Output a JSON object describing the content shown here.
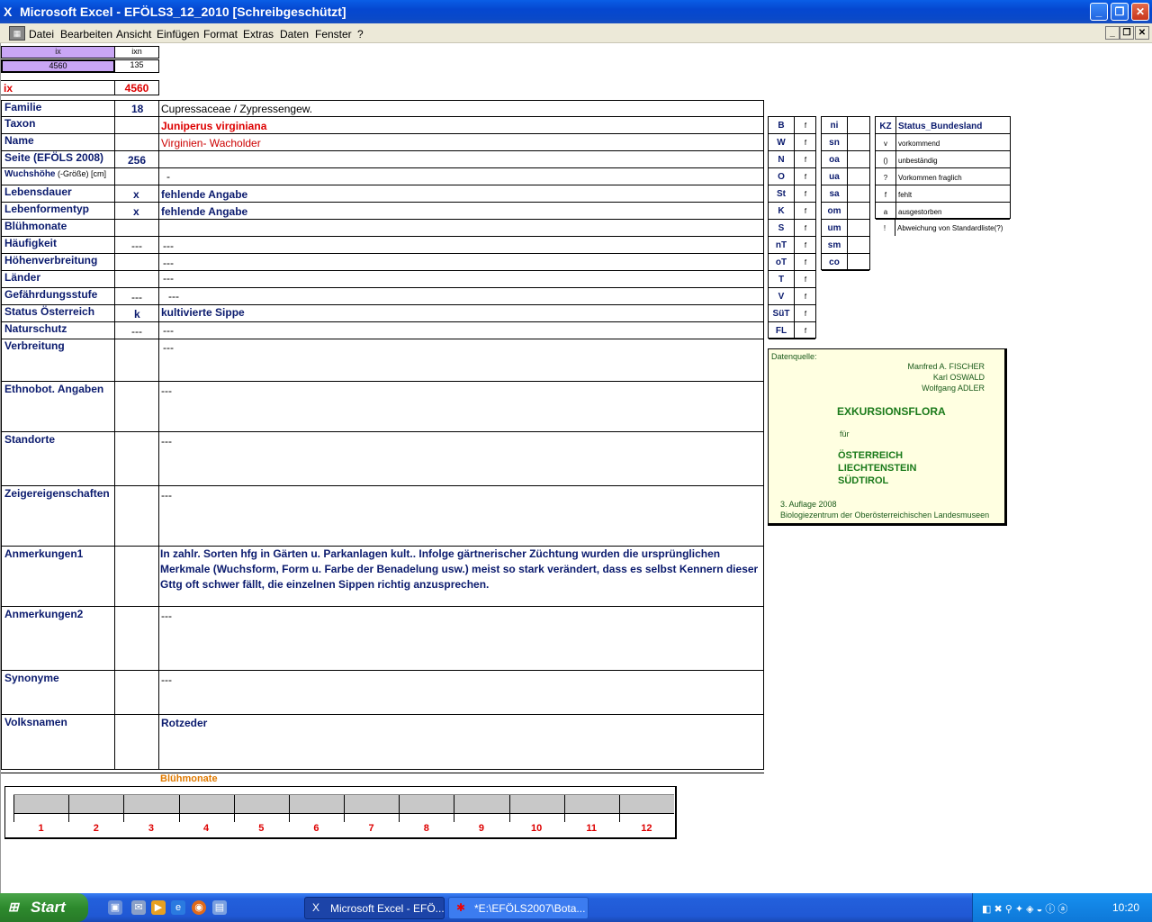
{
  "titlebar": {
    "title": "Microsoft Excel - EFÖLS3_12_2010  [Schreibgeschützt]"
  },
  "window_buttons": {
    "minimize": "_",
    "maximize": "❐",
    "close": "✕"
  },
  "menu": [
    "Datei",
    "Bearbeiten",
    "Ansicht",
    "Einfügen",
    "Format",
    "Extras",
    "Daten",
    "Fenster",
    "?"
  ],
  "top_index": {
    "h1": "ix",
    "h2": "ixn",
    "v1": "4560",
    "v2": "135",
    "ix_label": "ix",
    "ix_value": "4560"
  },
  "record": {
    "familie": {
      "label": "Familie",
      "code": "18",
      "value": "Cupressaceae  /  Zypressengew."
    },
    "taxon": {
      "label": "Taxon",
      "value": "Juniperus virginiana"
    },
    "name": {
      "label": "Name",
      "value": "Virginien- Wacholder"
    },
    "seite": {
      "label": "Seite (EFÖLS 2008)",
      "code": "256"
    },
    "wuchshoehe": {
      "label": "Wuchshöhe",
      "label_small": " (-Größe) [cm]",
      "value": "-"
    },
    "lebensdauer": {
      "label": "Lebensdauer",
      "code": "x",
      "value": "fehlende Angabe"
    },
    "lebensformentyp": {
      "label": "Lebenformentyp",
      "code": "x",
      "value": "fehlende Angabe"
    },
    "bluehmonate": {
      "label": "Blühmonate"
    },
    "haeufigkeit": {
      "label": "Häufigkeit",
      "code": "---",
      "value": "---"
    },
    "hoehenverbreitung": {
      "label": "Höhenverbreitung",
      "value": "---"
    },
    "laender": {
      "label": "Länder",
      "value": "---"
    },
    "gefaehrdung": {
      "label": "Gefährdungsstufe",
      "code": "---",
      "value": "---"
    },
    "status": {
      "label": "Status Österreich",
      "code": "k",
      "value": "kultivierte Sippe"
    },
    "naturschutz": {
      "label": "Naturschutz",
      "code": "---",
      "value": "---"
    },
    "verbreitung": {
      "label": "Verbreitung",
      "value": "---"
    },
    "ethnobot": {
      "label": "Ethnobot. Angaben",
      "value": "---"
    },
    "standorte": {
      "label": "Standorte",
      "value": "---"
    },
    "zeiger": {
      "label": "Zeigereigenschaften",
      "value": "---"
    },
    "anm1": {
      "label": "Anmerkungen1",
      "value": "In zahlr. Sorten hfg in Gärten u. Parkanlagen kult.. Infolge gärtnerischer Züchtung wurden die ursprünglichen Merkmale (Wuchsform, Form u. Farbe der Benadelung usw.) meist so stark verändert, dass es selbst Kennern dieser Gttg oft schwer fällt, die einzelnen Sippen richtig anzusprechen."
    },
    "anm2": {
      "label": "Anmerkungen2",
      "value": "---"
    },
    "synonyme": {
      "label": "Synonyme",
      "value": "---"
    },
    "volksnamen": {
      "label": "Volksnamen",
      "value": "Rotzeder"
    }
  },
  "regions": [
    {
      "code": "B",
      "flag": "f"
    },
    {
      "code": "W",
      "flag": "f"
    },
    {
      "code": "N",
      "flag": "f"
    },
    {
      "code": "O",
      "flag": "f"
    },
    {
      "code": "St",
      "flag": "f"
    },
    {
      "code": "K",
      "flag": "f"
    },
    {
      "code": "S",
      "flag": "f"
    },
    {
      "code": "nT",
      "flag": "f"
    },
    {
      "code": "oT",
      "flag": "f"
    },
    {
      "code": "T",
      "flag": "f"
    },
    {
      "code": "V",
      "flag": "f"
    },
    {
      "code": "SüT",
      "flag": "f"
    },
    {
      "code": "FL",
      "flag": "f"
    }
  ],
  "heights": [
    "ni",
    "sn",
    "oa",
    "ua",
    "sa",
    "om",
    "um",
    "sm",
    "co"
  ],
  "legend": {
    "kz_header": "KZ",
    "status_header": "Status_Bundesland",
    "rows": [
      {
        "kz": "v",
        "text": "vorkommend"
      },
      {
        "kz": "()",
        "text": "unbeständig"
      },
      {
        "kz": "?",
        "text": "Vorkommen fraglich"
      },
      {
        "kz": "f",
        "text": "fehlt"
      },
      {
        "kz": "a",
        "text": "ausgestorben"
      },
      {
        "kz": "!",
        "text": "Abweichung von Standardliste(?)"
      }
    ]
  },
  "source": {
    "label": "Datenquelle:",
    "author1": "Manfred A. FISCHER",
    "author2": "Karl OSWALD",
    "author3": "Wolfgang ADLER",
    "title": "EXKURSIONSFLORA",
    "fuer": "für",
    "c1": "ÖSTERREICH",
    "c2": "LIECHTENSTEIN",
    "c3": "SÜDTIROL",
    "edition": "3. Auflage 2008",
    "publisher": "Biologiezentrum der Oberösterreichischen Landesmuseen"
  },
  "bluehmonate_chart": {
    "title": "Blühmonate",
    "months": [
      "1",
      "2",
      "3",
      "4",
      "5",
      "6",
      "7",
      "8",
      "9",
      "10",
      "11",
      "12"
    ]
  },
  "taskbar": {
    "start": "Start",
    "task1": "Microsoft Excel - EFÖ...",
    "task2": "*E:\\EFÖLS2007\\Bota...",
    "clock": "10:20"
  }
}
